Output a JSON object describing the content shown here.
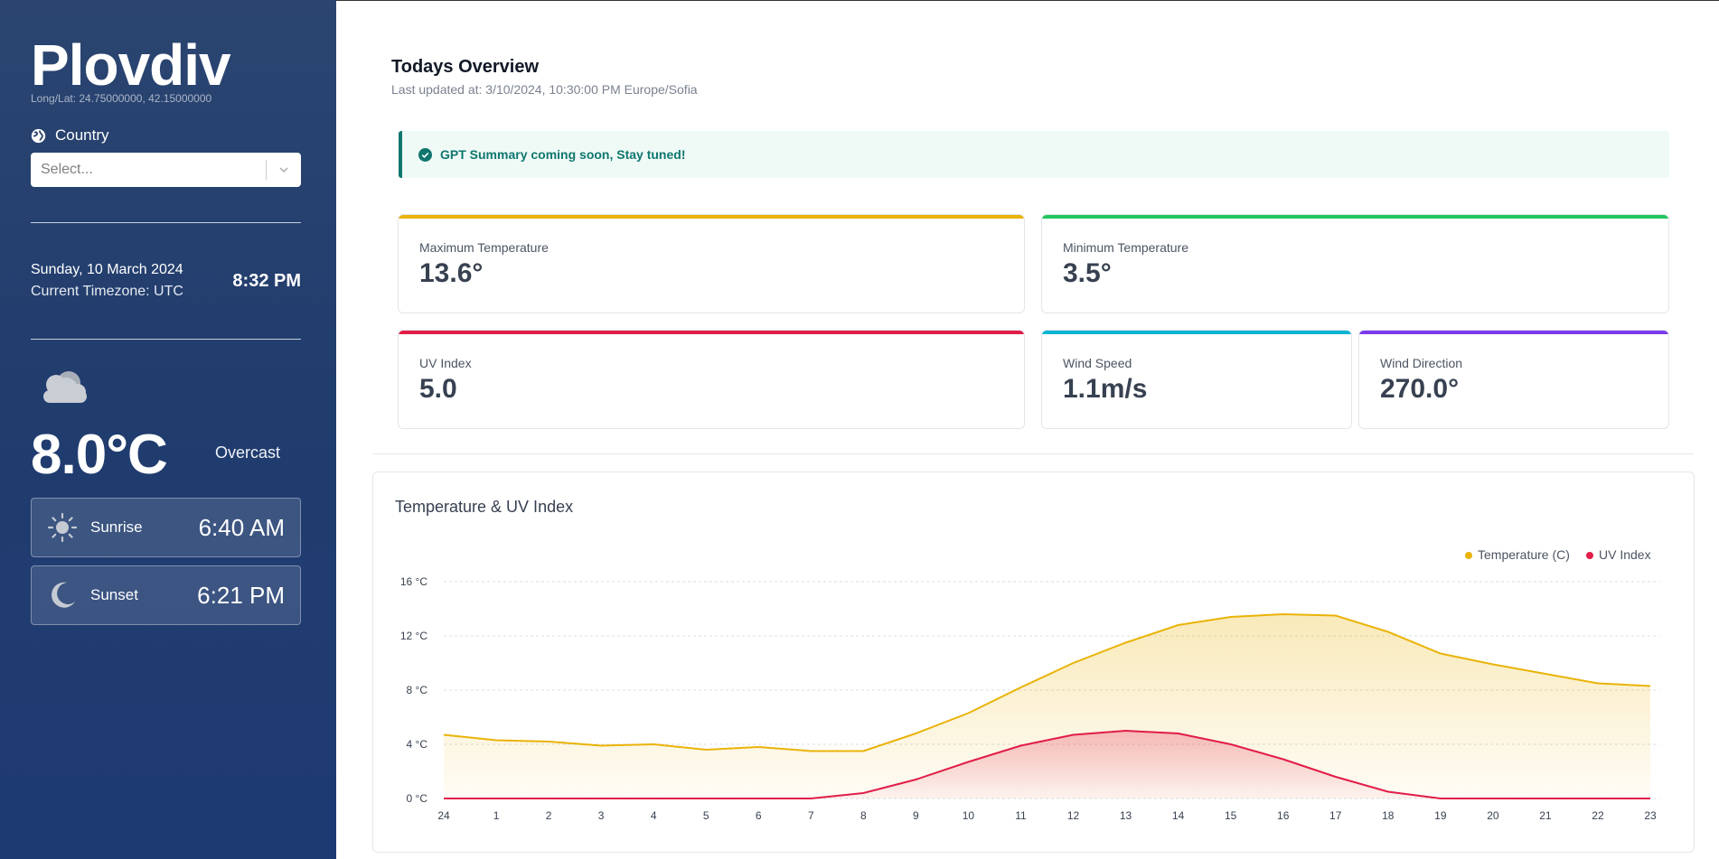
{
  "sidebar": {
    "city": "Plovdiv",
    "coords": "Long/Lat: 24.75000000, 42.15000000",
    "country_label": "Country",
    "country_placeholder": "Select...",
    "date": "Sunday, 10 March 2024",
    "timezone": "Current Timezone: UTC",
    "time": "8:32 PM",
    "weather_icon": "cloud-icon",
    "temperature": "8.0°C",
    "condition": "Overcast",
    "sunrise_label": "Sunrise",
    "sunrise_time": "6:40 AM",
    "sunset_label": "Sunset",
    "sunset_time": "6:21 PM"
  },
  "overview": {
    "title": "Todays Overview",
    "last_updated": "Last updated at: 3/10/2024, 10:30:00 PM Europe/Sofia",
    "alert": "GPT Summary coming soon, Stay tuned!",
    "cards": [
      {
        "label": "Maximum Temperature",
        "value": "13.6°",
        "color": "#eab308"
      },
      {
        "label": "Minimum Temperature",
        "value": "3.5°",
        "color": "#22c55e"
      },
      {
        "label": "UV Index",
        "value": "5.0",
        "color": "#e11d48"
      },
      {
        "label": "Wind Speed",
        "value": "1.1m/s",
        "color": "#06b6d4"
      },
      {
        "label": "Wind Direction",
        "value": "270.0°",
        "color": "#7c3aed"
      }
    ]
  },
  "chart_data": {
    "type": "area",
    "title": "Temperature & UV Index",
    "categories": [
      "24",
      "1",
      "2",
      "3",
      "4",
      "5",
      "6",
      "7",
      "8",
      "9",
      "10",
      "11",
      "12",
      "13",
      "14",
      "15",
      "16",
      "17",
      "18",
      "19",
      "20",
      "21",
      "22",
      "23"
    ],
    "series": [
      {
        "name": "Temperature (C)",
        "color": "#eab308",
        "values": [
          4.7,
          4.3,
          4.2,
          3.9,
          4.0,
          3.6,
          3.8,
          3.5,
          3.5,
          4.8,
          6.3,
          8.2,
          10.0,
          11.5,
          12.8,
          13.4,
          13.6,
          13.5,
          12.3,
          10.7,
          9.9,
          9.2,
          8.5,
          8.3
        ]
      },
      {
        "name": "UV Index",
        "color": "#e11d48",
        "values": [
          0,
          0,
          0,
          0,
          0,
          0,
          0,
          0,
          0.4,
          1.4,
          2.7,
          3.9,
          4.7,
          5.0,
          4.8,
          4.0,
          2.9,
          1.6,
          0.5,
          0,
          0,
          0,
          0,
          0
        ]
      }
    ],
    "yticks": [
      "0 °C",
      "4 °C",
      "8 °C",
      "12 °C",
      "16 °C"
    ],
    "ylim": [
      0,
      16
    ],
    "grid": true,
    "legend": "top-right"
  }
}
